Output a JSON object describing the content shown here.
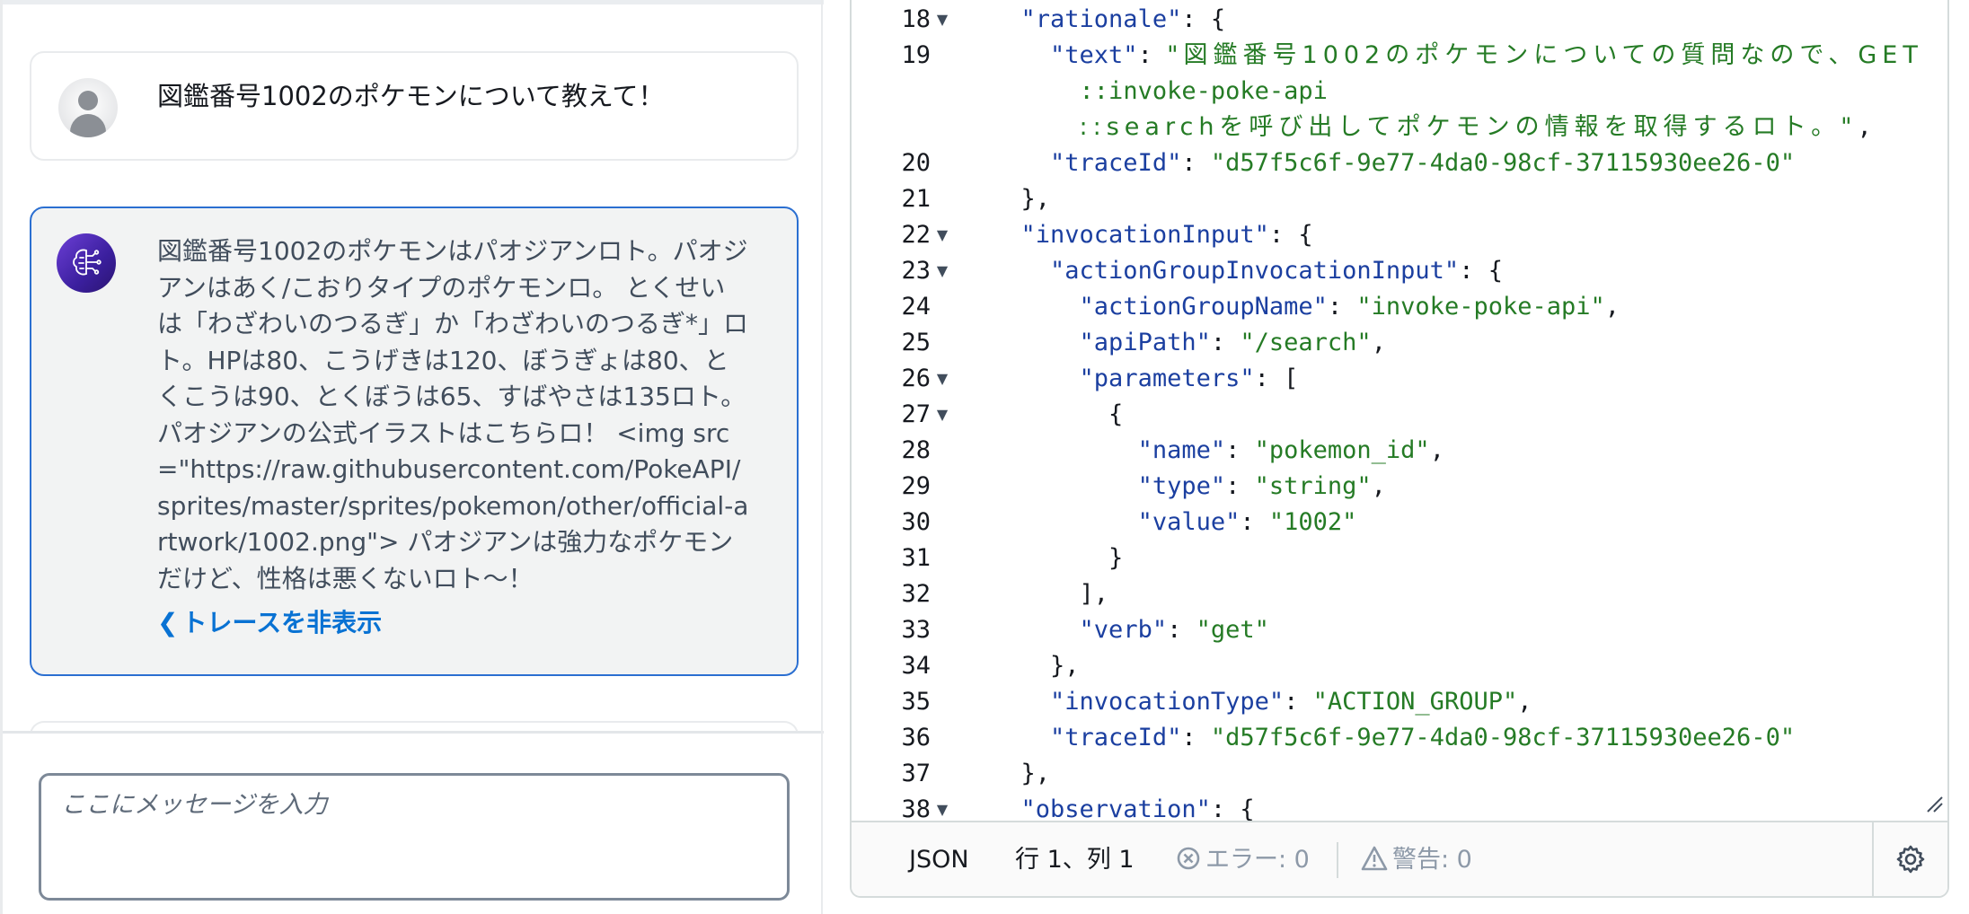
{
  "chat": {
    "user_message": "図鑑番号1002のポケモンについて教えて！",
    "agent_message": "図鑑番号1002のポケモンはパオジアンロト。パオジアンはあく/こおりタイプのポケモンロ。 とくせいは「わざわいのつるぎ」か「わざわいのつるぎ*」ロト。HPは80、こうげきは120、ぼうぎょは80、とくこうは90、とくぼうは65、すばやさは135ロト。 パオジアンの公式イラストはこちらロ！ <img src=\"https://raw.githubusercontent.com/PokeAPI/sprites/master/sprites/pokemon/other/official-artwork/1002.png\"> パオジアンは強力なポケモンだけど、性格は悪くないロト〜！",
    "trace_toggle_label": "トレースを非表示",
    "input_placeholder": "ここにメッセージを入力"
  },
  "editor": {
    "lines": [
      {
        "n": "18",
        "fold": true
      },
      {
        "n": "19",
        "fold": false
      },
      {
        "n": "",
        "fold": false
      },
      {
        "n": "",
        "fold": false
      },
      {
        "n": "20",
        "fold": false
      },
      {
        "n": "21",
        "fold": false
      },
      {
        "n": "22",
        "fold": true
      },
      {
        "n": "23",
        "fold": true
      },
      {
        "n": "24",
        "fold": false
      },
      {
        "n": "25",
        "fold": false
      },
      {
        "n": "26",
        "fold": true
      },
      {
        "n": "27",
        "fold": true
      },
      {
        "n": "28",
        "fold": false
      },
      {
        "n": "29",
        "fold": false
      },
      {
        "n": "30",
        "fold": false
      },
      {
        "n": "31",
        "fold": false
      },
      {
        "n": "32",
        "fold": false
      },
      {
        "n": "33",
        "fold": false
      },
      {
        "n": "34",
        "fold": false
      },
      {
        "n": "35",
        "fold": false
      },
      {
        "n": "36",
        "fold": false
      },
      {
        "n": "37",
        "fold": false
      },
      {
        "n": "38",
        "fold": true
      }
    ],
    "code": {
      "k_rationale": "\"rationale\"",
      "k_text": "\"text\"",
      "v_text_1": "\"図鑑番号1002のポケモンについての質問なので、GET",
      "v_text_2": "::invoke-poke-api",
      "v_text_3": "::searchを呼び出してポケモンの情報を取得するロト。\"",
      "k_traceId": "\"traceId\"",
      "v_traceId": "\"d57f5c6f-9e77-4da0-98cf-37115930ee26-0\"",
      "k_invocationInput": "\"invocationInput\"",
      "k_agii": "\"actionGroupInvocationInput\"",
      "k_agName": "\"actionGroupName\"",
      "v_agName": "\"invoke-poke-api\"",
      "k_apiPath": "\"apiPath\"",
      "v_apiPath": "\"/search\"",
      "k_parameters": "\"parameters\"",
      "k_name": "\"name\"",
      "v_name": "\"pokemon_id\"",
      "k_type": "\"type\"",
      "v_type": "\"string\"",
      "k_value": "\"value\"",
      "v_value": "\"1002\"",
      "k_verb": "\"verb\"",
      "v_verb": "\"get\"",
      "k_invocationType": "\"invocationType\"",
      "v_invocationType": "\"ACTION_GROUP\"",
      "k_observation": "\"observation\""
    },
    "status": {
      "mode": "JSON",
      "cursor": "行 1、列 1",
      "errors": "エラー: 0",
      "warnings": "警告: 0"
    }
  }
}
